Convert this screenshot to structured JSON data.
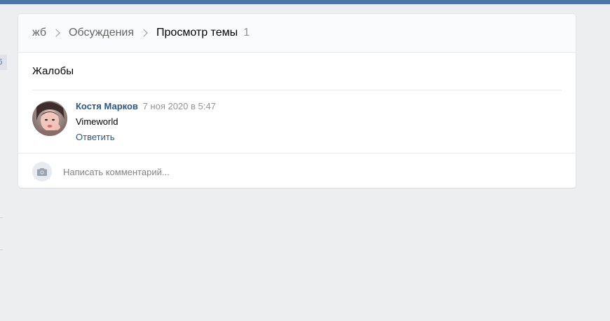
{
  "side": {
    "tab_label": "б"
  },
  "breadcrumb": {
    "group": "жб",
    "discussions": "Обсуждения",
    "current": "Просмотр темы",
    "count": "1"
  },
  "topic": {
    "title": "Жалобы"
  },
  "post": {
    "author": "Костя Марков",
    "date": "7 ноя 2020 в 5:47",
    "text": "Vimeworld",
    "reply_label": "Ответить"
  },
  "comment": {
    "placeholder": "Написать комментарий..."
  },
  "colors": {
    "topbar": "#4a76a8",
    "page_bg": "#edeef0",
    "link": "#2a5885",
    "muted": "#939393"
  },
  "icons": {
    "camera": "camera-icon",
    "chevron": "chevron-right-icon"
  }
}
